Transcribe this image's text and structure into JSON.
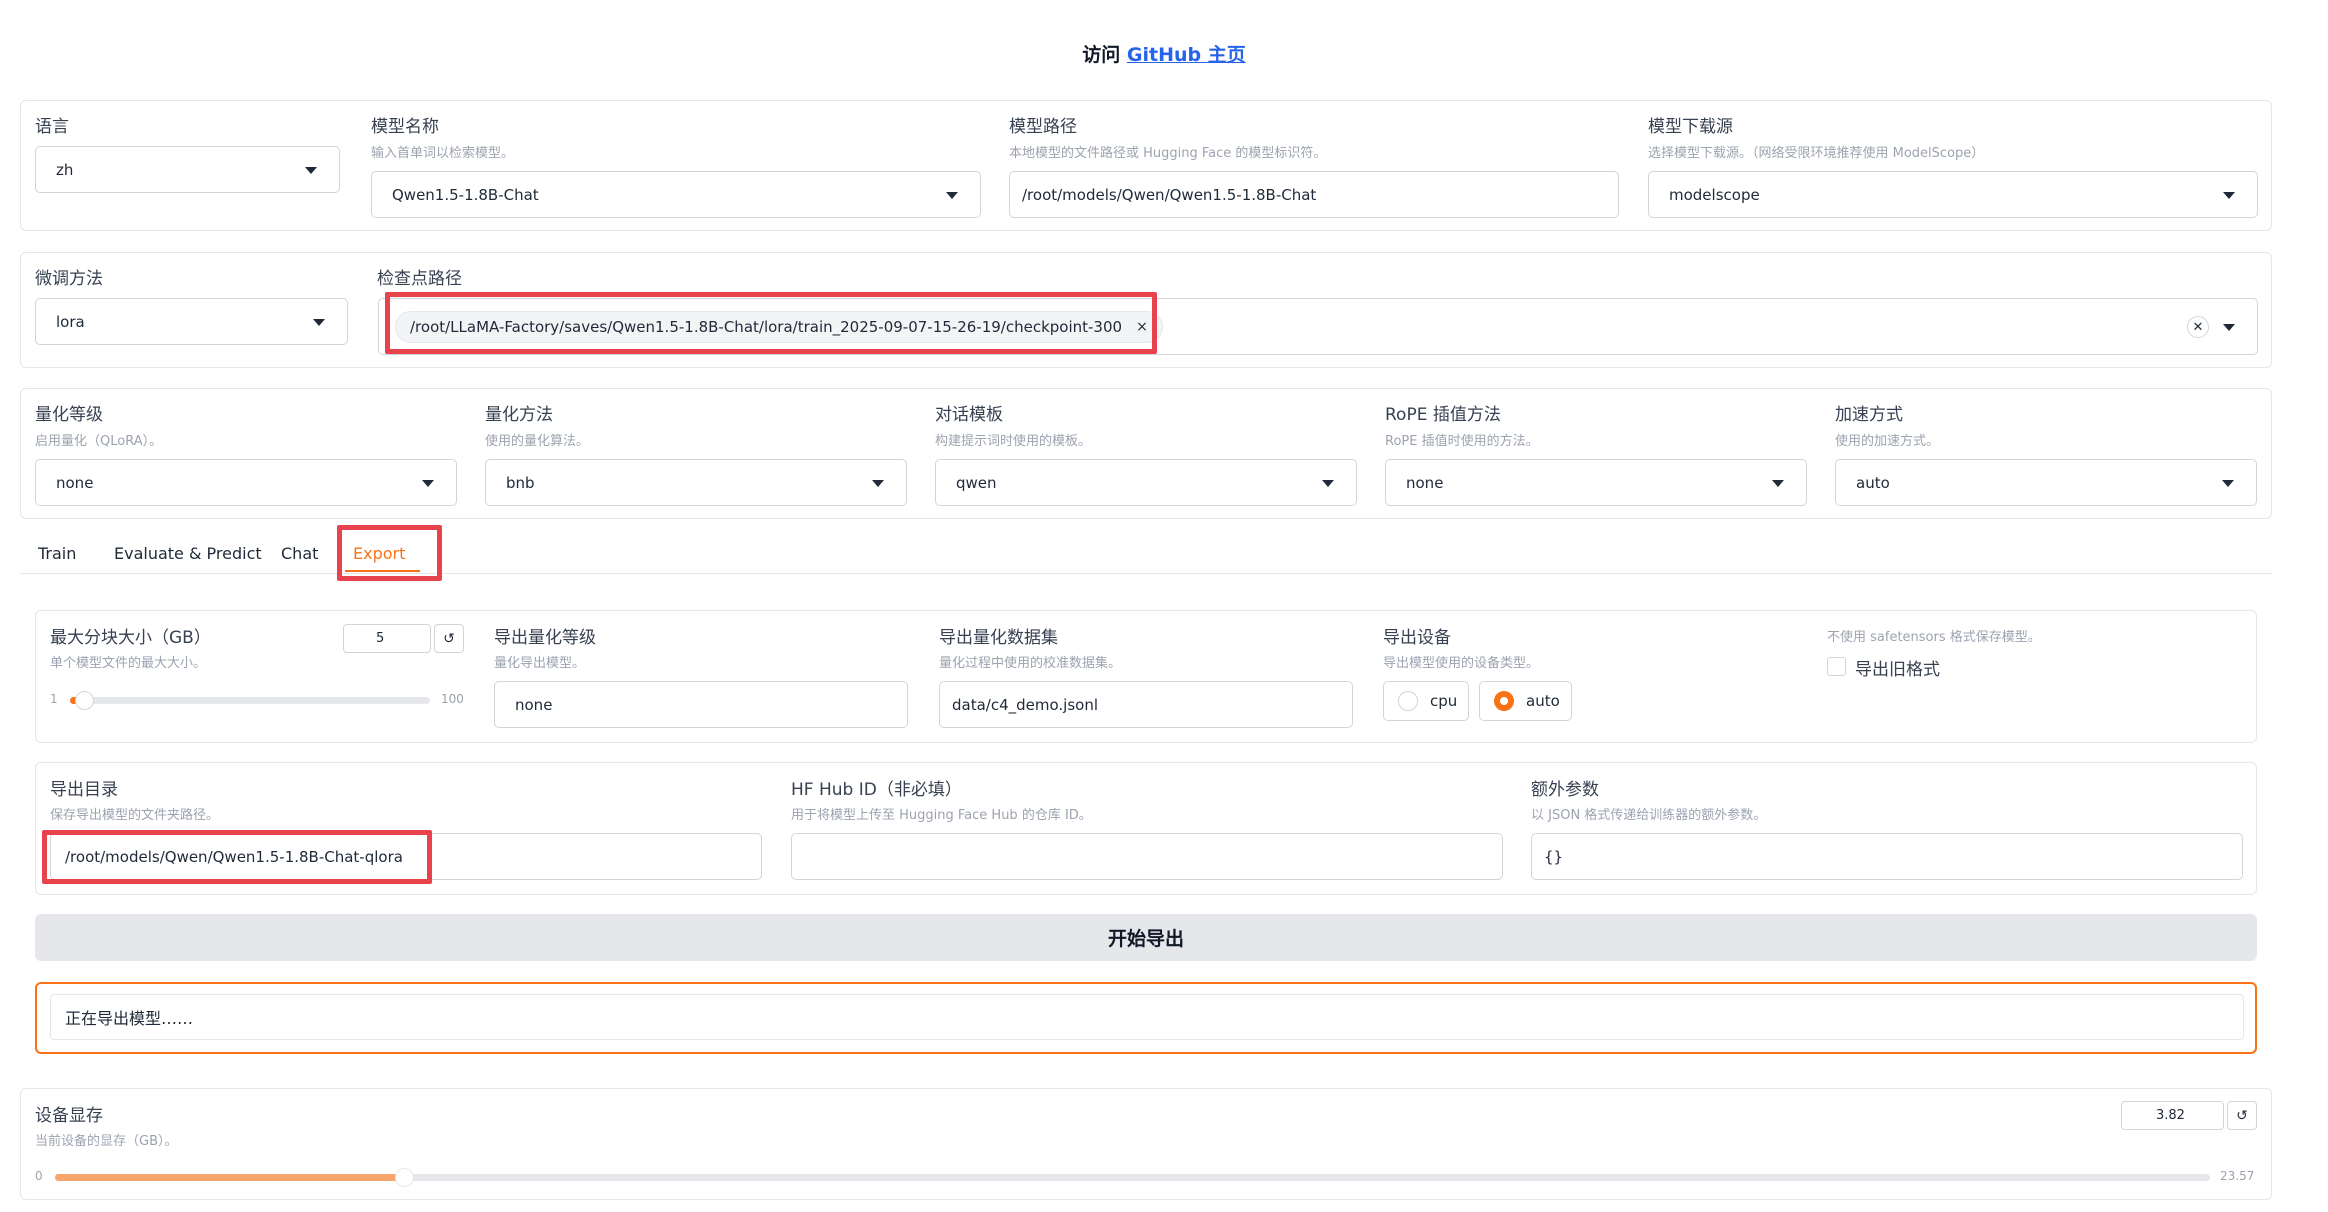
{
  "header": {
    "prefix": "访问 ",
    "link": "GitHub 主页"
  },
  "row1": {
    "lang": {
      "label": "语言",
      "value": "zh"
    },
    "model_name": {
      "label": "模型名称",
      "info": "输入首单词以检索模型。",
      "value": "Qwen1.5-1.8B-Chat"
    },
    "model_path": {
      "label": "模型路径",
      "info": "本地模型的文件路径或 Hugging Face 的模型标识符。",
      "value": "/root/models/Qwen/Qwen1.5-1.8B-Chat"
    },
    "hub": {
      "label": "模型下载源",
      "info": "选择模型下载源。（网络受限环境推荐使用 ModelScope）",
      "value": "modelscope"
    }
  },
  "row2": {
    "finetune": {
      "label": "微调方法",
      "value": "lora"
    },
    "checkpoint": {
      "label": "检查点路径",
      "chip": "/root/LLaMA-Factory/saves/Qwen1.5-1.8B-Chat/lora/train_2025-09-07-15-26-19/checkpoint-300",
      "chip_remove": "×",
      "clear": "✕"
    }
  },
  "row3": {
    "quant_bit": {
      "label": "量化等级",
      "info": "启用量化（QLoRA）。",
      "value": "none"
    },
    "quant_method": {
      "label": "量化方法",
      "info": "使用的量化算法。",
      "value": "bnb"
    },
    "template": {
      "label": "对话模板",
      "info": "构建提示词时使用的模板。",
      "value": "qwen"
    },
    "rope": {
      "label": "RoPE 插值方法",
      "info": "RoPE 插值时使用的方法。",
      "value": "none"
    },
    "booster": {
      "label": "加速方式",
      "info": "使用的加速方式。",
      "value": "auto"
    }
  },
  "tabs": [
    "Train",
    "Evaluate & Predict",
    "Chat",
    "Export"
  ],
  "active_tab": "Export",
  "export": {
    "size": {
      "label": "最大分块大小（GB）",
      "info": "单个模型文件的最大大小。",
      "value": "5",
      "reset": "↺",
      "min": "1",
      "max": "100",
      "fraction": 0.04
    },
    "quant": {
      "label": "导出量化等级",
      "info": "量化导出模型。",
      "value": "none"
    },
    "dataset": {
      "label": "导出量化数据集",
      "info": "量化过程中使用的校准数据集。",
      "value": "data/c4_demo.jsonl"
    },
    "device": {
      "label": "导出设备",
      "info": "导出模型使用的设备类型。",
      "options": [
        "cpu",
        "auto"
      ],
      "selected": "auto"
    },
    "legacy": {
      "info": "不使用 safetensors 格式保存模型。",
      "label": "导出旧格式"
    },
    "dir": {
      "label": "导出目录",
      "info": "保存导出模型的文件夹路径。",
      "value": "/root/models/Qwen/Qwen1.5-1.8B-Chat-qlora"
    },
    "hub_id": {
      "label": "HF Hub ID（非必填）",
      "info": "用于将模型上传至 Hugging Face Hub 的仓库 ID。",
      "value": ""
    },
    "extra": {
      "label": "额外参数",
      "info": "以 JSON 格式传递给训练器的额外参数。",
      "value": "{}"
    },
    "button": "开始导出",
    "status": "正在导出模型……"
  },
  "memory": {
    "label": "设备显存",
    "info": "当前设备的显存（GB）。",
    "value": "3.82",
    "reset": "↺",
    "min": "0",
    "max": "23.57",
    "fraction": 0.162
  },
  "colors": {
    "accent": "#f97316",
    "link": "#2563eb",
    "annotation": "#e8424c"
  }
}
